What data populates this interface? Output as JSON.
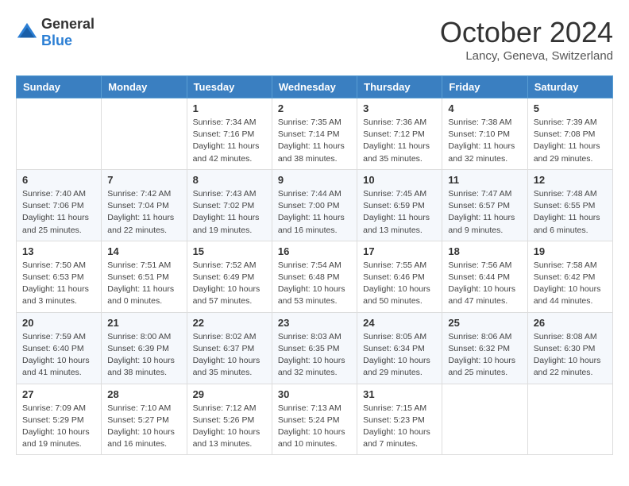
{
  "header": {
    "logo_general": "General",
    "logo_blue": "Blue",
    "month_title": "October 2024",
    "location": "Lancy, Geneva, Switzerland"
  },
  "weekdays": [
    "Sunday",
    "Monday",
    "Tuesday",
    "Wednesday",
    "Thursday",
    "Friday",
    "Saturday"
  ],
  "weeks": [
    [
      {
        "day": "",
        "sunrise": "",
        "sunset": "",
        "daylight": ""
      },
      {
        "day": "",
        "sunrise": "",
        "sunset": "",
        "daylight": ""
      },
      {
        "day": "1",
        "sunrise": "Sunrise: 7:34 AM",
        "sunset": "Sunset: 7:16 PM",
        "daylight": "Daylight: 11 hours and 42 minutes."
      },
      {
        "day": "2",
        "sunrise": "Sunrise: 7:35 AM",
        "sunset": "Sunset: 7:14 PM",
        "daylight": "Daylight: 11 hours and 38 minutes."
      },
      {
        "day": "3",
        "sunrise": "Sunrise: 7:36 AM",
        "sunset": "Sunset: 7:12 PM",
        "daylight": "Daylight: 11 hours and 35 minutes."
      },
      {
        "day": "4",
        "sunrise": "Sunrise: 7:38 AM",
        "sunset": "Sunset: 7:10 PM",
        "daylight": "Daylight: 11 hours and 32 minutes."
      },
      {
        "day": "5",
        "sunrise": "Sunrise: 7:39 AM",
        "sunset": "Sunset: 7:08 PM",
        "daylight": "Daylight: 11 hours and 29 minutes."
      }
    ],
    [
      {
        "day": "6",
        "sunrise": "Sunrise: 7:40 AM",
        "sunset": "Sunset: 7:06 PM",
        "daylight": "Daylight: 11 hours and 25 minutes."
      },
      {
        "day": "7",
        "sunrise": "Sunrise: 7:42 AM",
        "sunset": "Sunset: 7:04 PM",
        "daylight": "Daylight: 11 hours and 22 minutes."
      },
      {
        "day": "8",
        "sunrise": "Sunrise: 7:43 AM",
        "sunset": "Sunset: 7:02 PM",
        "daylight": "Daylight: 11 hours and 19 minutes."
      },
      {
        "day": "9",
        "sunrise": "Sunrise: 7:44 AM",
        "sunset": "Sunset: 7:00 PM",
        "daylight": "Daylight: 11 hours and 16 minutes."
      },
      {
        "day": "10",
        "sunrise": "Sunrise: 7:45 AM",
        "sunset": "Sunset: 6:59 PM",
        "daylight": "Daylight: 11 hours and 13 minutes."
      },
      {
        "day": "11",
        "sunrise": "Sunrise: 7:47 AM",
        "sunset": "Sunset: 6:57 PM",
        "daylight": "Daylight: 11 hours and 9 minutes."
      },
      {
        "day": "12",
        "sunrise": "Sunrise: 7:48 AM",
        "sunset": "Sunset: 6:55 PM",
        "daylight": "Daylight: 11 hours and 6 minutes."
      }
    ],
    [
      {
        "day": "13",
        "sunrise": "Sunrise: 7:50 AM",
        "sunset": "Sunset: 6:53 PM",
        "daylight": "Daylight: 11 hours and 3 minutes."
      },
      {
        "day": "14",
        "sunrise": "Sunrise: 7:51 AM",
        "sunset": "Sunset: 6:51 PM",
        "daylight": "Daylight: 11 hours and 0 minutes."
      },
      {
        "day": "15",
        "sunrise": "Sunrise: 7:52 AM",
        "sunset": "Sunset: 6:49 PM",
        "daylight": "Daylight: 10 hours and 57 minutes."
      },
      {
        "day": "16",
        "sunrise": "Sunrise: 7:54 AM",
        "sunset": "Sunset: 6:48 PM",
        "daylight": "Daylight: 10 hours and 53 minutes."
      },
      {
        "day": "17",
        "sunrise": "Sunrise: 7:55 AM",
        "sunset": "Sunset: 6:46 PM",
        "daylight": "Daylight: 10 hours and 50 minutes."
      },
      {
        "day": "18",
        "sunrise": "Sunrise: 7:56 AM",
        "sunset": "Sunset: 6:44 PM",
        "daylight": "Daylight: 10 hours and 47 minutes."
      },
      {
        "day": "19",
        "sunrise": "Sunrise: 7:58 AM",
        "sunset": "Sunset: 6:42 PM",
        "daylight": "Daylight: 10 hours and 44 minutes."
      }
    ],
    [
      {
        "day": "20",
        "sunrise": "Sunrise: 7:59 AM",
        "sunset": "Sunset: 6:40 PM",
        "daylight": "Daylight: 10 hours and 41 minutes."
      },
      {
        "day": "21",
        "sunrise": "Sunrise: 8:00 AM",
        "sunset": "Sunset: 6:39 PM",
        "daylight": "Daylight: 10 hours and 38 minutes."
      },
      {
        "day": "22",
        "sunrise": "Sunrise: 8:02 AM",
        "sunset": "Sunset: 6:37 PM",
        "daylight": "Daylight: 10 hours and 35 minutes."
      },
      {
        "day": "23",
        "sunrise": "Sunrise: 8:03 AM",
        "sunset": "Sunset: 6:35 PM",
        "daylight": "Daylight: 10 hours and 32 minutes."
      },
      {
        "day": "24",
        "sunrise": "Sunrise: 8:05 AM",
        "sunset": "Sunset: 6:34 PM",
        "daylight": "Daylight: 10 hours and 29 minutes."
      },
      {
        "day": "25",
        "sunrise": "Sunrise: 8:06 AM",
        "sunset": "Sunset: 6:32 PM",
        "daylight": "Daylight: 10 hours and 25 minutes."
      },
      {
        "day": "26",
        "sunrise": "Sunrise: 8:08 AM",
        "sunset": "Sunset: 6:30 PM",
        "daylight": "Daylight: 10 hours and 22 minutes."
      }
    ],
    [
      {
        "day": "27",
        "sunrise": "Sunrise: 7:09 AM",
        "sunset": "Sunset: 5:29 PM",
        "daylight": "Daylight: 10 hours and 19 minutes."
      },
      {
        "day": "28",
        "sunrise": "Sunrise: 7:10 AM",
        "sunset": "Sunset: 5:27 PM",
        "daylight": "Daylight: 10 hours and 16 minutes."
      },
      {
        "day": "29",
        "sunrise": "Sunrise: 7:12 AM",
        "sunset": "Sunset: 5:26 PM",
        "daylight": "Daylight: 10 hours and 13 minutes."
      },
      {
        "day": "30",
        "sunrise": "Sunrise: 7:13 AM",
        "sunset": "Sunset: 5:24 PM",
        "daylight": "Daylight: 10 hours and 10 minutes."
      },
      {
        "day": "31",
        "sunrise": "Sunrise: 7:15 AM",
        "sunset": "Sunset: 5:23 PM",
        "daylight": "Daylight: 10 hours and 7 minutes."
      },
      {
        "day": "",
        "sunrise": "",
        "sunset": "",
        "daylight": ""
      },
      {
        "day": "",
        "sunrise": "",
        "sunset": "",
        "daylight": ""
      }
    ]
  ]
}
